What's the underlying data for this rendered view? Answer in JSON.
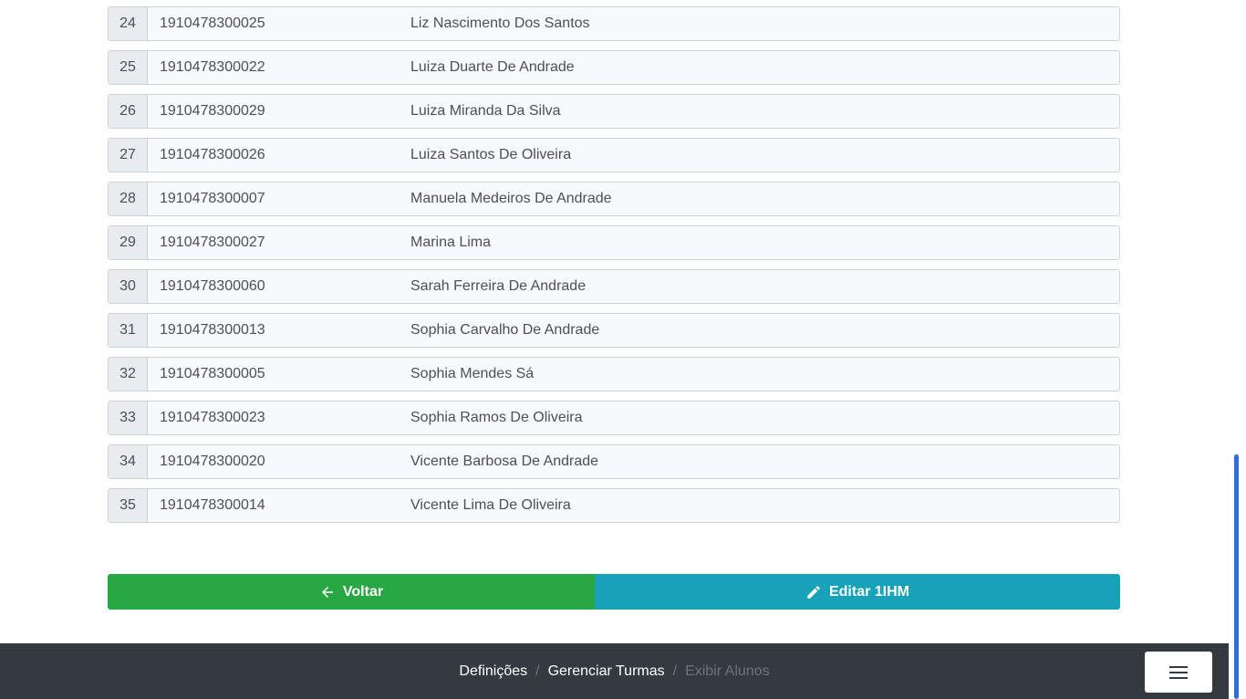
{
  "students": [
    {
      "num": "24",
      "matricula": "1910478300025",
      "nome": "Liz Nascimento Dos Santos"
    },
    {
      "num": "25",
      "matricula": "1910478300022",
      "nome": "Luiza Duarte De Andrade"
    },
    {
      "num": "26",
      "matricula": "1910478300029",
      "nome": "Luiza Miranda Da Silva"
    },
    {
      "num": "27",
      "matricula": "1910478300026",
      "nome": "Luiza Santos De Oliveira"
    },
    {
      "num": "28",
      "matricula": "1910478300007",
      "nome": "Manuela Medeiros De Andrade"
    },
    {
      "num": "29",
      "matricula": "1910478300027",
      "nome": "Marina Lima"
    },
    {
      "num": "30",
      "matricula": "1910478300060",
      "nome": "Sarah Ferreira De Andrade"
    },
    {
      "num": "31",
      "matricula": "1910478300013",
      "nome": "Sophia Carvalho De Andrade"
    },
    {
      "num": "32",
      "matricula": "1910478300005",
      "nome": "Sophia Mendes Sá"
    },
    {
      "num": "33",
      "matricula": "1910478300023",
      "nome": "Sophia Ramos De Oliveira"
    },
    {
      "num": "34",
      "matricula": "1910478300020",
      "nome": "Vicente Barbosa De Andrade"
    },
    {
      "num": "35",
      "matricula": "1910478300014",
      "nome": "Vicente Lima De Oliveira"
    }
  ],
  "actions": {
    "back_label": "Voltar",
    "back_icon": "arrow-left-icon",
    "edit_label": "Editar 1IHM",
    "edit_icon": "pencil-icon"
  },
  "breadcrumb": {
    "items": [
      "Definições",
      "Gerenciar Turmas",
      "Exibir Alunos"
    ],
    "separator": "/"
  },
  "footer": {
    "menu_icon": "hamburger-menu-icon"
  },
  "colors": {
    "back_button": "#28a745",
    "edit_button": "#17a2b8",
    "footer_bg": "#343a40",
    "scroll_thumb": "#2d6cdf"
  }
}
